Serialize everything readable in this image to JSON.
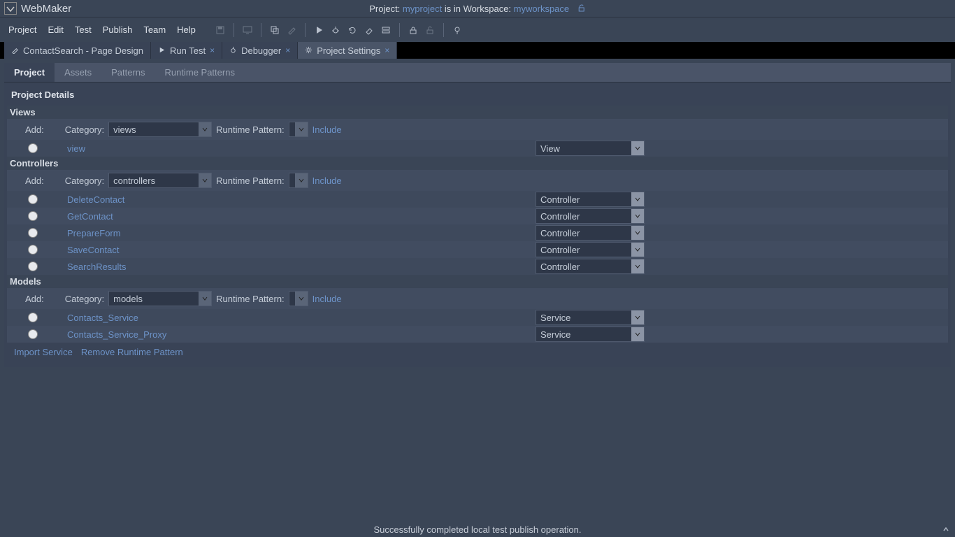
{
  "app": {
    "title": "WebMaker"
  },
  "projectInfo": {
    "prefix": "Project:",
    "project": "myproject",
    "mid": "is in Workspace:",
    "workspace": "myworkspace"
  },
  "menu": {
    "project": "Project",
    "edit": "Edit",
    "test": "Test",
    "publish": "Publish",
    "team": "Team",
    "help": "Help"
  },
  "editorTabs": {
    "t1": "ContactSearch - Page Design",
    "t2": "Run Test",
    "t3": "Debugger",
    "t4": "Project Settings"
  },
  "subTabs": {
    "project": "Project",
    "assets": "Assets",
    "patterns": "Patterns",
    "runtimePatterns": "Runtime Patterns"
  },
  "panel": {
    "title": "Project Details",
    "addLabel": "Add:",
    "categoryLabel": "Category:",
    "runtimePatternLabel": "Runtime Pattern:",
    "includeLink": "Include",
    "importService": "Import Service",
    "removeRuntimePattern": "Remove Runtime Pattern"
  },
  "sections": {
    "views": {
      "title": "Views",
      "category": "views",
      "items": [
        {
          "name": "view",
          "type": "View"
        }
      ]
    },
    "controllers": {
      "title": "Controllers",
      "category": "controllers",
      "items": [
        {
          "name": "DeleteContact",
          "type": "Controller"
        },
        {
          "name": "GetContact",
          "type": "Controller"
        },
        {
          "name": "PrepareForm",
          "type": "Controller"
        },
        {
          "name": "SaveContact",
          "type": "Controller"
        },
        {
          "name": "SearchResults",
          "type": "Controller"
        }
      ]
    },
    "models": {
      "title": "Models",
      "category": "models",
      "items": [
        {
          "name": "Contacts_Service",
          "type": "Service"
        },
        {
          "name": "Contacts_Service_Proxy",
          "type": "Service"
        }
      ]
    }
  },
  "status": {
    "message": "Successfully completed local test publish operation."
  }
}
